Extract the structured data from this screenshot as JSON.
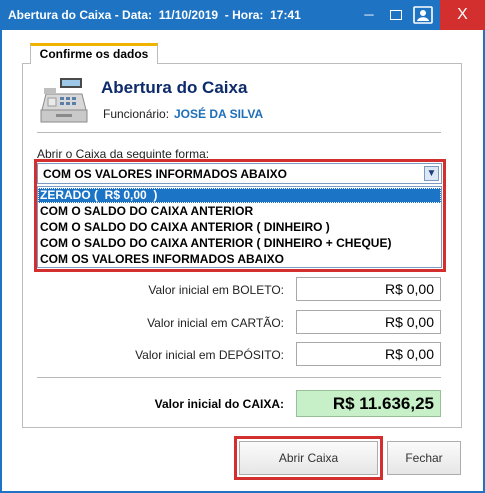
{
  "window": {
    "title": "Abertura do Caixa - Data:  11/10/2019  - Hora:  17:41",
    "minimize_glyph": "─",
    "close_glyph": "X"
  },
  "tab": {
    "label": "Confirme os dados"
  },
  "header": {
    "title": "Abertura do Caixa",
    "employee_label": "Funcionário:",
    "employee_name": "JOSÉ DA SILVA"
  },
  "opening_mode": {
    "label": "Abrir o Caixa da seguinte forma:",
    "selected_value": "COM OS VALORES INFORMADOS ABAIXO",
    "arrow_glyph": "▼",
    "options": [
      "ZERADO (  R$ 0,00  )",
      "COM O SALDO DO CAIXA ANTERIOR",
      "COM O SALDO DO CAIXA ANTERIOR ( DINHEIRO )",
      "COM O SALDO DO CAIXA ANTERIOR ( DINHEIRO + CHEQUE)",
      "COM OS VALORES INFORMADOS ABAIXO"
    ],
    "highlighted_option": "ZERADO (  R$ 0,00  )"
  },
  "values": {
    "boleto": {
      "label": "Valor inicial em BOLETO:",
      "value": "R$ 0,00"
    },
    "cartao": {
      "label": "Valor inicial em CARTÃO:",
      "value": "R$ 0,00"
    },
    "deposito": {
      "label": "Valor inicial em DEPÓSITO:",
      "value": "R$ 0,00"
    },
    "total": {
      "label": "Valor inicial do CAIXA:",
      "value": "R$ 11.636,25"
    }
  },
  "buttons": {
    "open": "Abrir Caixa",
    "close": "Fechar"
  },
  "colors": {
    "titlebar": "#1e74c3",
    "close": "#d32f2f",
    "highlight_frame": "#d32f2f",
    "selection": "#1c74c7",
    "total_bg": "#c8f0c8",
    "tab_accent": "#f0b400"
  }
}
